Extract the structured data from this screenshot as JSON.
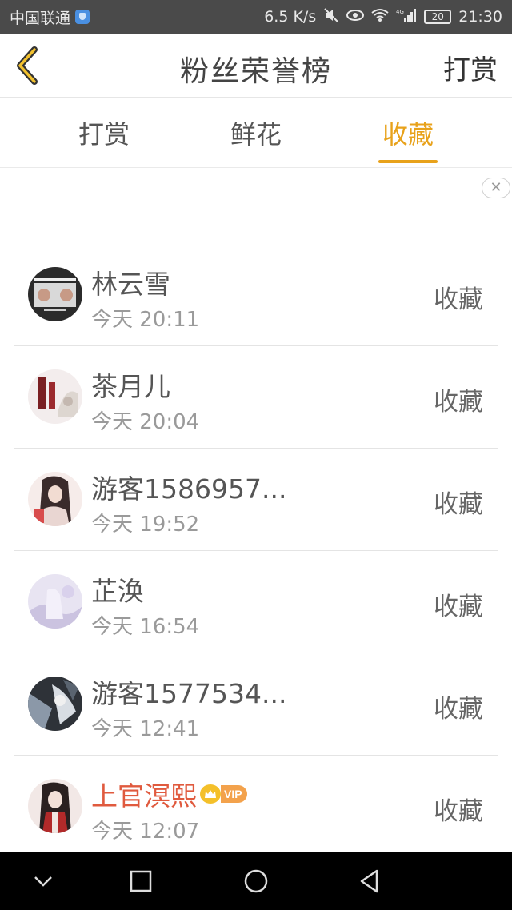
{
  "status_bar": {
    "carrier": "中国联通",
    "speed": "6.5 K/s",
    "network": "4G",
    "battery": "20",
    "time": "21:30"
  },
  "header": {
    "title": "粉丝荣誉榜",
    "right_action": "打赏"
  },
  "tabs": [
    {
      "label": "打赏",
      "active": false
    },
    {
      "label": "鲜花",
      "active": false
    },
    {
      "label": "收藏",
      "active": true
    }
  ],
  "ad_close": "✕",
  "list": [
    {
      "name": "林云雪",
      "time": "今天 20:11",
      "action": "收藏",
      "vip": false
    },
    {
      "name": "茶月儿",
      "time": "今天 20:04",
      "action": "收藏",
      "vip": false
    },
    {
      "name": "游客1586957...",
      "time": "今天 19:52",
      "action": "收藏",
      "vip": false
    },
    {
      "name": "芷涣",
      "time": "今天 16:54",
      "action": "收藏",
      "vip": false
    },
    {
      "name": "游客1577534...",
      "time": "今天 12:41",
      "action": "收藏",
      "vip": false
    },
    {
      "name": "上官溟熙",
      "time": "今天 12:07",
      "action": "收藏",
      "vip": true,
      "vip_label": "VIP"
    }
  ],
  "colors": {
    "accent": "#e8a21b",
    "vip_name": "#e05a3e",
    "status_bar": "#4a4a4a",
    "nav_bar": "#000000"
  },
  "icons": {
    "back": "chevron-left-icon",
    "nav_down": "chevron-down-icon",
    "nav_recent": "square-icon",
    "nav_home": "circle-icon",
    "nav_back": "triangle-back-icon"
  }
}
